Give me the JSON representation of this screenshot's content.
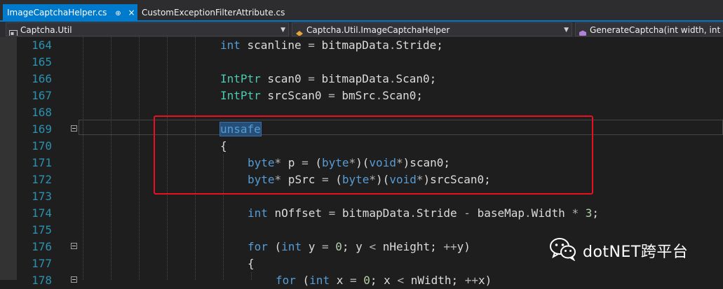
{
  "tabs": [
    {
      "label": "ImageCaptchaHelper.cs",
      "pin": "⊕",
      "close": "×",
      "active": true
    },
    {
      "label": "CustomExceptionFilterAttribute.cs",
      "active": false
    }
  ],
  "navigation": {
    "project": "Captcha.Util",
    "type": "Captcha.Util.ImageCaptchaHelper",
    "member": "GenerateCaptcha(int width, int he"
  },
  "code_lines": [
    {
      "num": "164",
      "text": "int scanline = bitmapData.Stride;"
    },
    {
      "num": "165",
      "text": ""
    },
    {
      "num": "166",
      "text": "IntPtr scan0 = bitmapData.Scan0;"
    },
    {
      "num": "167",
      "text": "IntPtr srcScan0 = bmSrc.Scan0;"
    },
    {
      "num": "168",
      "text": ""
    },
    {
      "num": "169",
      "text": "unsafe"
    },
    {
      "num": "170",
      "text": "{"
    },
    {
      "num": "171",
      "text": "byte* p = (byte*)(void*)scan0;"
    },
    {
      "num": "172",
      "text": "byte* pSrc = (byte*)(void*)srcScan0;"
    },
    {
      "num": "173",
      "text": ""
    },
    {
      "num": "174",
      "text": "int nOffset = bitmapData.Stride - baseMap.Width * 3;"
    },
    {
      "num": "175",
      "text": ""
    },
    {
      "num": "176",
      "text": "for (int y = 0; y < nHeight; ++y)"
    },
    {
      "num": "177",
      "text": "{"
    },
    {
      "num": "178",
      "text": "for (int x = 0; x < nWidth; ++x)"
    }
  ],
  "watermark": "dotNET跨平台",
  "colors": {
    "editor_bg": "#1e1e1e",
    "line_number": "#2b91af",
    "keyword": "#569cd6",
    "type": "#4ec9b0",
    "number": "#b5cea8",
    "highlight_box": "#e81123",
    "active_tab": "#007acc"
  },
  "icons": [
    "pin-icon",
    "close-icon",
    "namespace-icon",
    "class-icon",
    "method-icon",
    "fold-toggle-icon",
    "wechat-icon"
  ]
}
